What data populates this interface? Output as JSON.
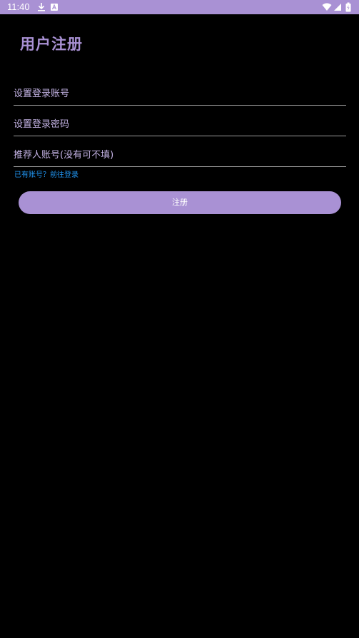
{
  "status_bar": {
    "time": "11:40",
    "background_color": "#a991d4",
    "left_icons": [
      "download-icon",
      "notification-a-icon"
    ],
    "right_icons": [
      "wifi-icon",
      "signal-icon",
      "battery-icon"
    ]
  },
  "page": {
    "title": "用户注册",
    "accent_color": "#a991d4"
  },
  "form": {
    "account_placeholder": "设置登录账号",
    "account_value": "",
    "password_placeholder": "设置登录密码",
    "password_value": "",
    "referrer_placeholder": "推荐人账号(没有可不填)",
    "referrer_value": "",
    "login_link_text": "已有账号？前往登录",
    "link_color": "#2196f3",
    "register_label": "注册"
  }
}
